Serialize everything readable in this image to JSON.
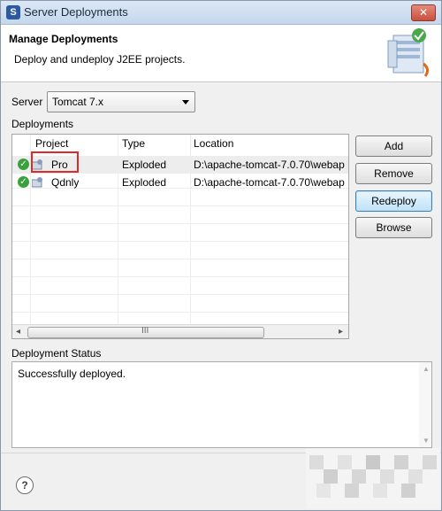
{
  "window": {
    "title": "Server Deployments",
    "close_label": "✕"
  },
  "banner": {
    "title": "Manage Deployments",
    "description": "Deploy and undeploy J2EE projects."
  },
  "server": {
    "label": "Server",
    "selected": "Tomcat  7.x"
  },
  "deployments": {
    "label": "Deployments",
    "columns": [
      "Project",
      "Type",
      "Location"
    ],
    "rows": [
      {
        "project": "Pro",
        "type": "Exploded",
        "location": "D:\\apache-tomcat-7.0.70\\webap"
      },
      {
        "project": "Qdnly",
        "type": "Exploded",
        "location": "D:\\apache-tomcat-7.0.70\\webap"
      }
    ],
    "scroll_grip": "III"
  },
  "buttons": {
    "add": "Add",
    "remove": "Remove",
    "redeploy": "Redeploy",
    "browse": "Browse"
  },
  "status": {
    "label": "Deployment Status",
    "text": "Successfully deployed."
  },
  "help": {
    "glyph": "?"
  }
}
